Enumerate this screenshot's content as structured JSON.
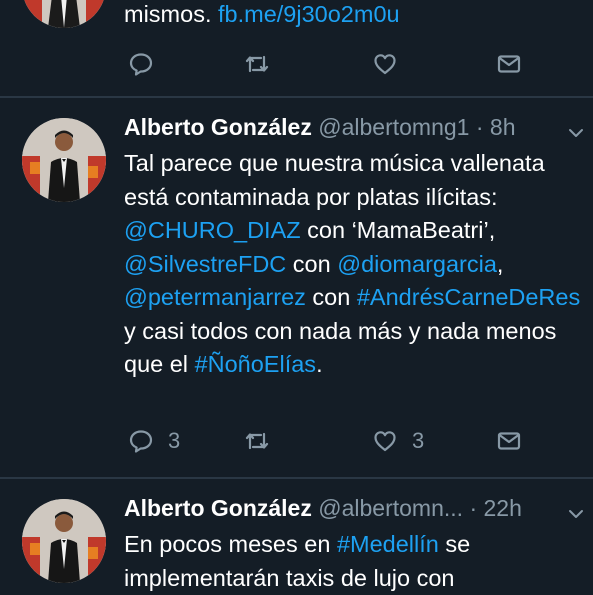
{
  "tweets": [
    {
      "text_parts": [
        {
          "text": "mismos. ",
          "link": false
        },
        {
          "text": "fb.me/9j30o2m0u",
          "link": true
        }
      ],
      "actions": {
        "reply_count": "",
        "like_count": ""
      }
    },
    {
      "name": "Alberto González",
      "handle": "@albertomng1",
      "separator": "·",
      "time": "8h",
      "text_parts": [
        {
          "text": "Tal parece que nuestra música vallenata está contaminada por platas ilícitas: ",
          "link": false
        },
        {
          "text": "@CHURO_DIAZ",
          "link": true
        },
        {
          "text": " con ‘MamaBeatri’, ",
          "link": false
        },
        {
          "text": "@SilvestreFDC",
          "link": true
        },
        {
          "text": " con ",
          "link": false
        },
        {
          "text": "@diomargarcia",
          "link": true
        },
        {
          "text": ", ",
          "link": false
        },
        {
          "text": "@petermanjarrez",
          "link": true
        },
        {
          "text": " con ",
          "link": false
        },
        {
          "text": "#AndrésCarneDeRes",
          "link": true
        },
        {
          "text": " y casi todos con nada más y nada menos que el ",
          "link": false
        },
        {
          "text": "#ÑoñoElías",
          "link": true
        },
        {
          "text": ".",
          "link": false
        }
      ],
      "actions": {
        "reply_count": "3",
        "like_count": "3"
      }
    },
    {
      "name": "Alberto González",
      "handle": "@albertomn...",
      "separator": "·",
      "time": "22h",
      "text_parts": [
        {
          "text": "En pocos meses en ",
          "link": false
        },
        {
          "text": "#Medellín",
          "link": true
        },
        {
          "text": " se implementarán taxis de lujo con",
          "link": false
        }
      ]
    }
  ],
  "icons": {
    "reply": "reply-icon",
    "retweet": "retweet-icon",
    "like": "like-icon",
    "message": "direct-message-icon",
    "menu": "chevron-down-icon"
  },
  "colors": {
    "background": "#141d26",
    "link": "#1da1f2",
    "muted": "#8899a6",
    "divider": "#2a3744"
  }
}
